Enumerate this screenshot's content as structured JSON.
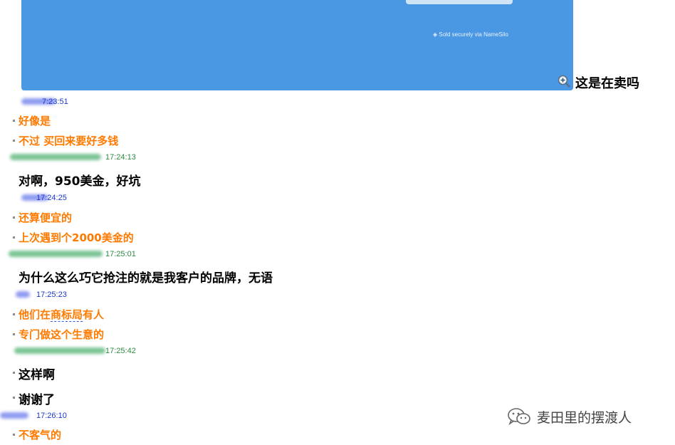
{
  "screenshot": {
    "secure_text": "Sold securely via NameSilo",
    "caption": "这是在卖吗"
  },
  "chat": [
    {
      "kind": "meta",
      "color": "blue",
      "time": "7:23:51"
    },
    {
      "kind": "msg",
      "color": "orange",
      "text": "好像是"
    },
    {
      "kind": "msg",
      "color": "orange",
      "text": "不过  买回来要好多钱"
    },
    {
      "kind": "meta",
      "color": "green",
      "time": "17:24:13"
    },
    {
      "kind": "msg",
      "color": "black",
      "text": "对啊，950美金，好坑"
    },
    {
      "kind": "meta",
      "color": "blue",
      "time": "17:24:25"
    },
    {
      "kind": "msg",
      "color": "orange",
      "text": "还算便宜的"
    },
    {
      "kind": "msg",
      "color": "orange",
      "text": "上次遇到个2000美金的"
    },
    {
      "kind": "meta",
      "color": "green",
      "time": "17:25:01"
    },
    {
      "kind": "msg",
      "color": "black",
      "text": "为什么这么巧它抢注的就是我客户的品牌，无语"
    },
    {
      "kind": "meta",
      "color": "blue",
      "time": "17:25:23"
    },
    {
      "kind": "msg",
      "color": "orange",
      "text_pre": "他们在",
      "text_ul": "商标局",
      "text_post": "有人"
    },
    {
      "kind": "msg",
      "color": "orange",
      "text": "专门做这个生意的"
    },
    {
      "kind": "meta",
      "color": "green",
      "time": "17:25:42"
    },
    {
      "kind": "msg",
      "color": "black",
      "text": "这样啊"
    },
    {
      "kind": "msg",
      "color": "black",
      "text": "谢谢了"
    },
    {
      "kind": "meta",
      "color": "blue",
      "time": "17:26:10"
    },
    {
      "kind": "msg",
      "color": "orange",
      "text": "不客气的"
    }
  ],
  "watermark": {
    "text": "麦田里的摆渡人",
    "icon": "wechat-icon"
  }
}
